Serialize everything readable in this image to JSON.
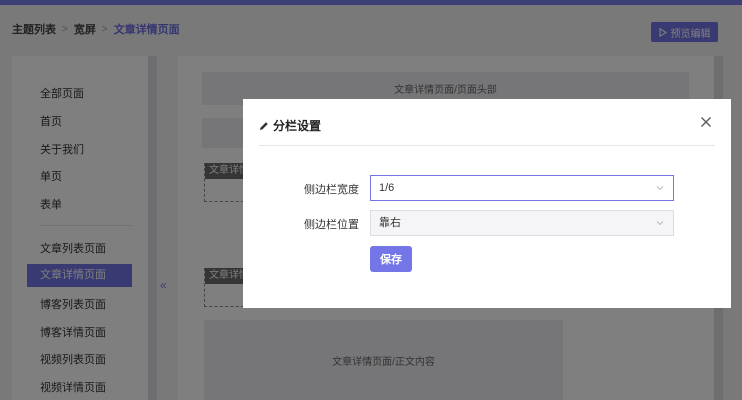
{
  "breadcrumb": [
    {
      "label": "主题列表"
    },
    {
      "label": "宽屏"
    },
    {
      "label": "文章详情页面"
    }
  ],
  "toolbar": {
    "preview_label": "预览编辑"
  },
  "sidebar": {
    "group1": [
      "全部页面",
      "首页",
      "关于我们",
      "单页",
      "表单"
    ],
    "group2": [
      "文章列表页面",
      "文章详情页面",
      "博客列表页面",
      "博客详情页面",
      "视频列表页面",
      "视频详情页面"
    ],
    "active_item": "文章详情页面",
    "collapse_icon": "«"
  },
  "canvas": {
    "header_block": "文章详情页面/页面头部",
    "tag1": "文章详情",
    "tag2": "文章详情",
    "body_block": "文章详情页面/正文内容"
  },
  "modal": {
    "title": "分栏设置",
    "fields": [
      {
        "label": "侧边栏宽度",
        "value": "1/6"
      },
      {
        "label": "侧边栏位置",
        "value": "靠右"
      }
    ],
    "save_label": "保存"
  },
  "colors": {
    "accent": "#7475e6",
    "topbar": "#7c7ee8"
  },
  "icons": [
    "play-icon",
    "pencil-icon",
    "close-icon",
    "chevron-down-icon",
    "double-chevron-left-icon"
  ]
}
